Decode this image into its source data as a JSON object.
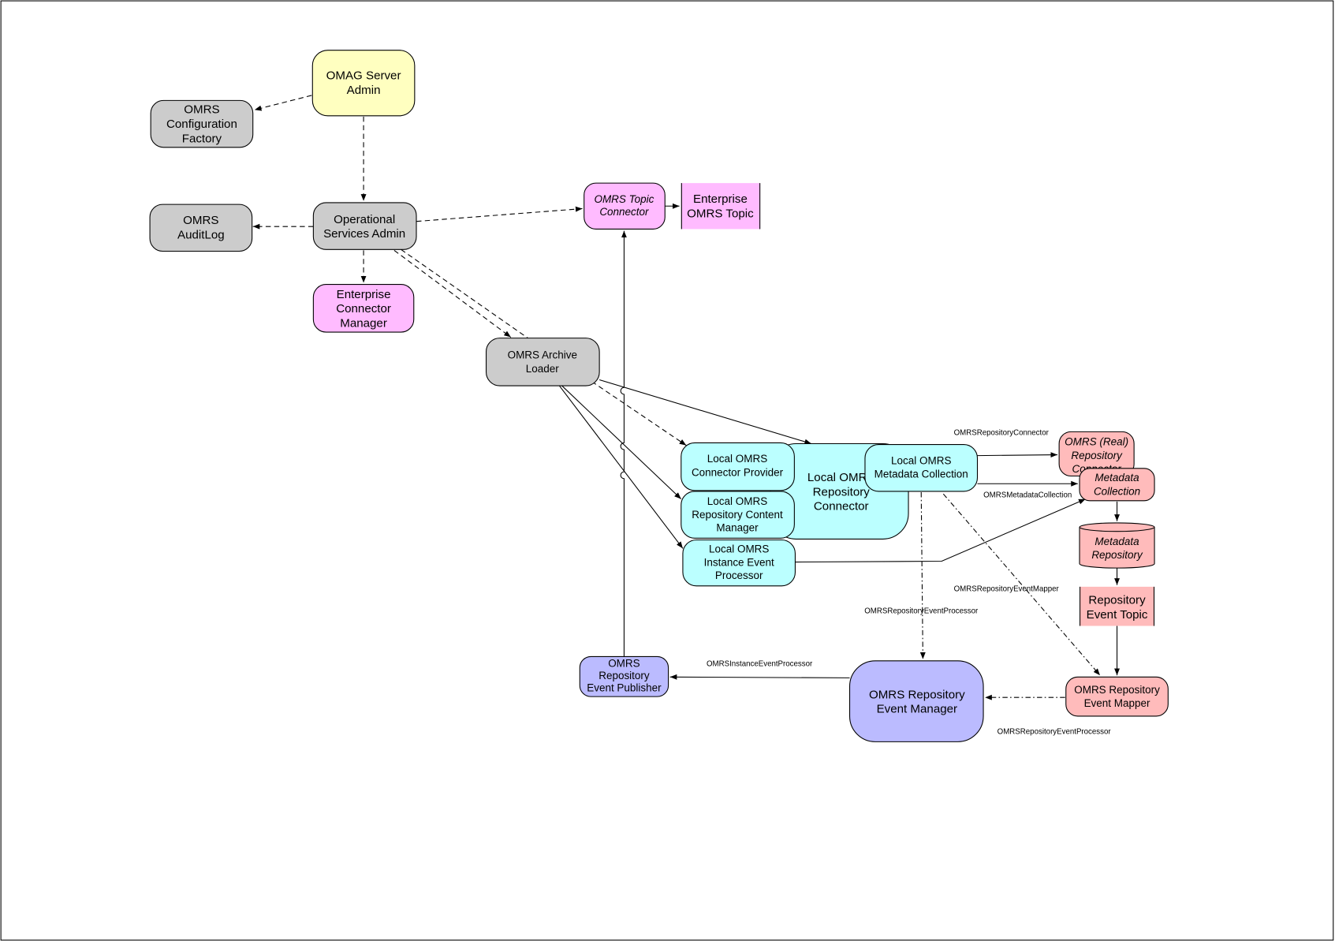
{
  "colors": {
    "server_admin": "#ffffc0",
    "core_services": "#cccccc",
    "enterprise": "#ffbbff",
    "local_repository": "#bbffff",
    "real_repository": "#ffbbbb",
    "event_management": "#bbbbff"
  },
  "nodes": {
    "omag_server_admin": [
      "OMAG Server",
      "Admin"
    ],
    "config_factory": [
      "OMRS",
      "Configuration",
      "Factory"
    ],
    "audit_log": [
      "OMRS",
      "AuditLog"
    ],
    "operational_services_admin": [
      "Operational",
      "Services Admin"
    ],
    "enterprise_connector_manager": [
      "Enterprise",
      "Connector",
      "Manager"
    ],
    "topic_connector": [
      "OMRS Topic",
      "Connector"
    ],
    "enterprise_topic": [
      "Enterprise",
      "OMRS Topic"
    ],
    "archive_loader": [
      "OMRS Archive",
      "Loader"
    ],
    "local_repository_connector": [
      "Local OMRS",
      "Repository",
      "Connector"
    ],
    "connector_provider": [
      "Local OMRS",
      "Connector Provider"
    ],
    "content_manager": [
      "Local OMRS",
      "Repository Content",
      "Manager"
    ],
    "instance_event_processor": [
      "Local OMRS",
      "Instance Event",
      "Processor"
    ],
    "local_metadata_collection": [
      "Local OMRS",
      "Metadata Collection"
    ],
    "real_repository_connector": [
      "OMRS (Real)",
      "Repository",
      "Connector"
    ],
    "metadata_collection": [
      "Metadata",
      "Collection"
    ],
    "metadata_repository": [
      "Metadata",
      "Repository"
    ],
    "repository_event_topic": [
      "Repository",
      "Event Topic"
    ],
    "repository_event_mapper": [
      "OMRS Repository",
      "Event Mapper"
    ],
    "repository_event_manager": [
      "OMRS Repository",
      "Event Manager"
    ],
    "repository_event_publisher": [
      "OMRS",
      "Repository",
      "Event Publisher"
    ]
  },
  "edge_labels": {
    "repository_connector": "OMRSRepositoryConnector",
    "metadata_collection": "OMRSMetadataCollection",
    "event_mapper": "OMRSRepositoryEventMapper",
    "event_processor_1": "OMRSRepositoryEventProcessor",
    "instance_event_processor": "OMRSInstanceEventProcessor",
    "event_processor_2": "OMRSRepositoryEventProcessor"
  }
}
